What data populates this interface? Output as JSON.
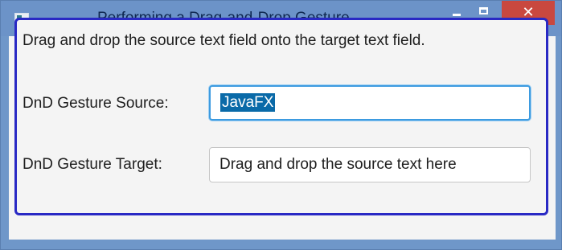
{
  "window": {
    "title": "Performing a Drag-and-Drop Gesture",
    "close_glyph": "✕"
  },
  "content": {
    "instruction": "Drag and drop the source text field onto the target text field.",
    "source": {
      "label": "DnD Gesture Source:",
      "value": "JavaFX",
      "selected": true
    },
    "target": {
      "label": "DnD Gesture Target:",
      "value": "Drag and drop the source text here"
    }
  },
  "colors": {
    "titlebar": "#6c93c8",
    "close_button": "#c9483f",
    "frame_border": "#2929c4",
    "focus_border": "#3d9be0",
    "selection": "#0a6aa8"
  },
  "icons": {
    "app": "app-icon",
    "minimize": "minimize-icon",
    "maximize": "maximize-icon",
    "close": "close-icon"
  }
}
